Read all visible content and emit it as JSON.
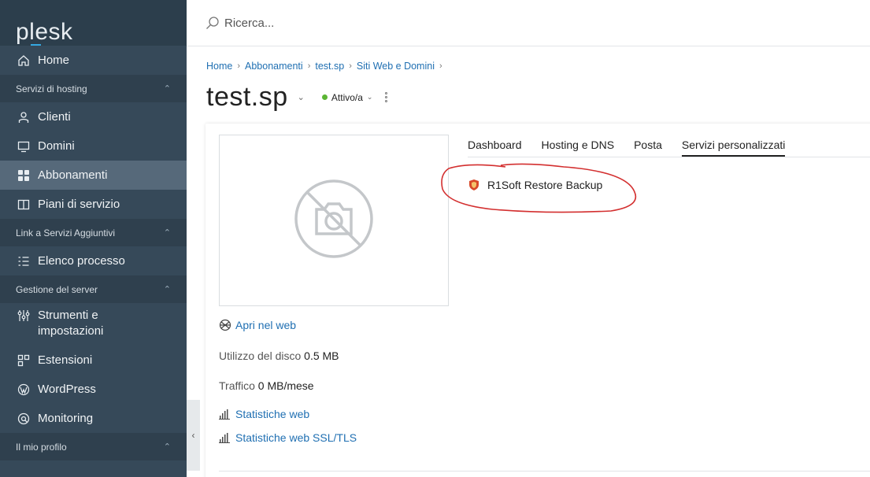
{
  "sidebar": {
    "logo": "plesk",
    "items": [
      {
        "label": "Home",
        "icon": "home-icon"
      },
      {
        "label": "Clienti",
        "icon": "user-icon"
      },
      {
        "label": "Domini",
        "icon": "monitor-icon"
      },
      {
        "label": "Abbonamenti",
        "icon": "grid-icon"
      },
      {
        "label": "Piani di servizio",
        "icon": "book-icon"
      },
      {
        "label": "Elenco processo",
        "icon": "checklist-icon"
      },
      {
        "label": "Strumenti e impostazioni",
        "icon": "sliders-icon"
      },
      {
        "label": "Estensioni",
        "icon": "extensions-icon"
      },
      {
        "label": "WordPress",
        "icon": "wordpress-icon"
      },
      {
        "label": "Monitoring",
        "icon": "monitoring-icon"
      }
    ],
    "sections": {
      "hosting": "Servizi di hosting",
      "links": "Link a Servizi Aggiuntivi",
      "server": "Gestione del server",
      "profile": "Il mio profilo"
    },
    "active_item": "Abbonamenti"
  },
  "search": {
    "placeholder": "Ricerca..."
  },
  "breadcrumb": [
    "Home",
    "Abbonamenti",
    "test.sp",
    "Siti Web e Domini"
  ],
  "page": {
    "title": "test.sp",
    "status": "Attivo/a",
    "status_color": "#5bb534"
  },
  "summary": {
    "open_web": "Apri nel web",
    "disk_label": "Utilizzo del disco",
    "disk_value": "0.5 MB",
    "traffic_label": "Traffico",
    "traffic_value": "0 MB/mese",
    "web_stats": "Statistiche web",
    "web_stats_ssl": "Statistiche web SSL/TLS"
  },
  "tabs": [
    "Dashboard",
    "Hosting e DNS",
    "Posta",
    "Servizi personalizzati"
  ],
  "active_tab": "Servizi personalizzati",
  "services": [
    {
      "label": "R1Soft Restore Backup",
      "icon": "shield-icon"
    }
  ],
  "colors": {
    "sidebar": "#364959",
    "link": "#1f6fb2",
    "annotation": "#d32f2f"
  }
}
